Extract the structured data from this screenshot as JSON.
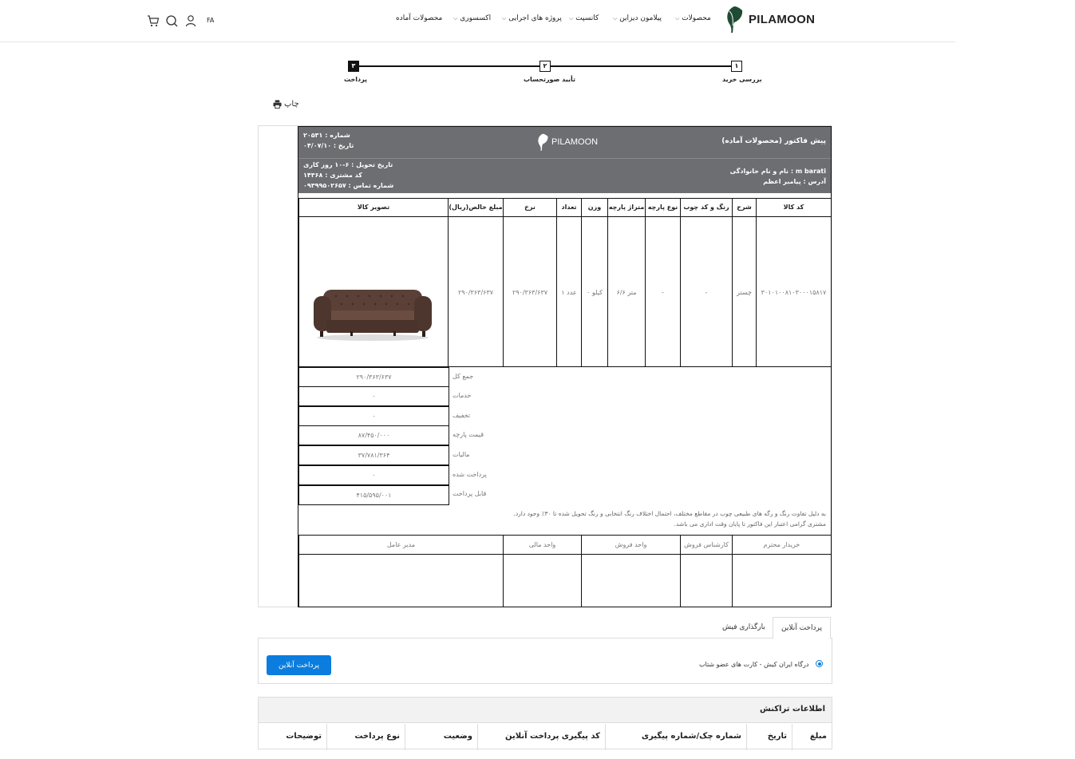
{
  "nav": {
    "brand": "PILAMOON",
    "menu": [
      "محصولات",
      "پیلامون دیزاین",
      "کانسپت",
      "پروژه های اجرایی",
      "اکسسوری",
      "محصولات آماده"
    ],
    "lang": "FA",
    "icons": [
      "cart-icon",
      "search-icon",
      "user-icon"
    ]
  },
  "steps": [
    {
      "num": "۱",
      "label": "بررسی خرید"
    },
    {
      "num": "۲",
      "label": "تأیید صورتحساب"
    },
    {
      "num": "۳",
      "label": "پرداخت"
    }
  ],
  "print_label": "چاپ",
  "invoice": {
    "title": "پیش فاکتور (محصولات آماده)",
    "brand": "PILAMOON",
    "number": "شماره : ۲۰۵۳۱",
    "date": "تاریخ : ۰۴/۰۷/۱۰",
    "customer_name": "نام و نام خانوادگی : m barati",
    "address": "آدرس : پیامبر اعظم",
    "delivery": "تاریخ تحویل : ۶-۱۰ روز کاری",
    "customer_code": "کد مشتری : ۱۴۳۶۸",
    "phone": "شماره تماس : ۰۹۳۹۹۵۰۲۶۵۷",
    "columns": [
      "کد کالا",
      "شرح",
      "رنگ و کد چوب",
      "نوع پارچه",
      "متراژ پارچه",
      "وزن",
      "تعداد",
      "نرخ",
      "مبلغ خالص(ریال)",
      "تصویر کالا"
    ],
    "row": [
      "۳۰۱۰۱۰۰۸۱۰۳۰۰۰۱۵۸۱۷",
      "چستر",
      "-",
      "-",
      "۶/۶ متر",
      "۰ کیلو",
      "۱ عدد",
      "۲۹۰/۳۶۳/۶۳۷",
      "۲۹۰/۳۶۳/۶۳۷",
      ""
    ],
    "summary": [
      {
        "label": "جمع کل",
        "value": "۲۹۰/۳۶۳/۶۳۷"
      },
      {
        "label": "خدمات",
        "value": "۰"
      },
      {
        "label": "تخفیف",
        "value": "۰"
      },
      {
        "label": "قیمت پارچه",
        "value": "۸۷/۴۵۰/۰۰۰"
      },
      {
        "label": "مالیات",
        "value": "۳۷/۷۸۱/۳۶۴"
      },
      {
        "label": "پرداخت شده",
        "value": "۰"
      },
      {
        "label": "قابل پرداخت",
        "value": "۴۱۵/۵۹۵/۰۰۱"
      }
    ],
    "note1": "به دلیل تفاوت رنگ و رگه های طبیعی چوب در مقاطع مختلف، احتمال اختلاف رنگ انتخابی و رنگ تحویل شده تا ۳۰٪ وجود دارد.",
    "note2": "مشتری گرامی اعتبار این فاکتور تا پایان وقت اداری می باشد.",
    "signatures": [
      "خریدار محترم",
      "کارشناس فروش",
      "واحد فروش",
      "واحد مالی",
      "مدیر عامل"
    ]
  },
  "payment": {
    "tabs": [
      "پرداخت آنلاین",
      "بارگذاری فیش"
    ],
    "gateway": "درگاه ایران کیش - کارت های عضو شتاب",
    "button": "پرداخت آنلاین"
  },
  "transactions": {
    "title": "اطلاعات تراکنش",
    "columns": [
      "مبلغ",
      "تاریخ",
      "شماره چک/شماره پیگیری",
      "کد پیگیری پرداخت آنلاین",
      "وضعیت",
      "نوع پرداخت",
      "توضیحات"
    ]
  }
}
